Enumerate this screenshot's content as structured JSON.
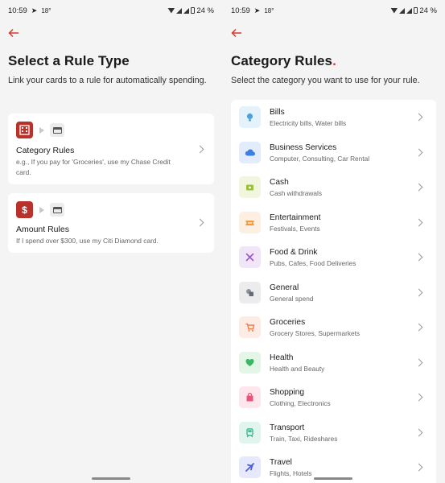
{
  "status": {
    "time": "10:59",
    "temp": "18°",
    "battery": "24 %"
  },
  "left": {
    "title": "Select a Rule Type",
    "subtitle": "Link your cards to a rule for automatically spending.",
    "rules": [
      {
        "name": "Category Rules",
        "desc": "e.g., If you pay for 'Groceries', use my Chase Credit card."
      },
      {
        "name": "Amount Rules",
        "desc": "If I spend over $300, use my Citi Diamond card."
      }
    ]
  },
  "right": {
    "title": "Category Rules",
    "title_dot": ".",
    "subtitle": "Select the category you want to use for your rule.",
    "categories": [
      {
        "name": "Bills",
        "desc": "Electricity bills, Water bills",
        "icon": "lightbulb-icon",
        "bg": "#e3f2fb",
        "fg": "#4aa3df"
      },
      {
        "name": "Business Services",
        "desc": "Computer, Consulting, Car Rental",
        "icon": "cloud-icon",
        "bg": "#e3ecfb",
        "fg": "#3f7fe0"
      },
      {
        "name": "Cash",
        "desc": "Cash withdrawals",
        "icon": "cash-icon",
        "bg": "#f1f7df",
        "fg": "#9bc13c"
      },
      {
        "name": "Entertainment",
        "desc": "Festivals, Events",
        "icon": "ticket-icon",
        "bg": "#fdf0e3",
        "fg": "#f09a3e"
      },
      {
        "name": "Food & Drink",
        "desc": "Pubs, Cafes, Food Deliveries",
        "icon": "utensils-icon",
        "bg": "#f0e6f8",
        "fg": "#9b59c6"
      },
      {
        "name": "General",
        "desc": "General spend",
        "icon": "shapes-icon",
        "bg": "#ececee",
        "fg": "#666a73"
      },
      {
        "name": "Groceries",
        "desc": "Grocery Stores, Supermarkets",
        "icon": "cart-icon",
        "bg": "#fdece4",
        "fg": "#ef7a4d"
      },
      {
        "name": "Health",
        "desc": "Health and Beauty",
        "icon": "heart-icon",
        "bg": "#e3f6e8",
        "fg": "#3cb862"
      },
      {
        "name": "Shopping",
        "desc": "Clothing, Electronics",
        "icon": "bag-icon",
        "bg": "#fde6ec",
        "fg": "#e8557c"
      },
      {
        "name": "Transport",
        "desc": "Train, Taxi, Rideshares",
        "icon": "train-icon",
        "bg": "#e1f5ee",
        "fg": "#37b389"
      },
      {
        "name": "Travel",
        "desc": "Flights, Hotels",
        "icon": "plane-icon",
        "bg": "#e6e8fb",
        "fg": "#4d5fd6"
      }
    ]
  },
  "colors": {
    "accent": "#d23b30",
    "amount_icon": "#b8312b"
  }
}
